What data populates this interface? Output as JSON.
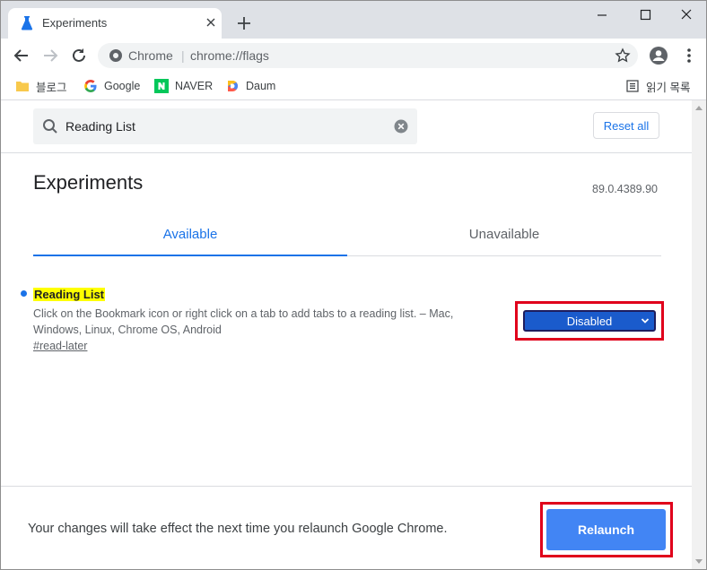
{
  "browser": {
    "tab_title": "Experiments",
    "omnibox_site": "Chrome",
    "omnibox_separator": "|",
    "omnibox_url": "chrome://flags"
  },
  "bookmarks": [
    {
      "label": "블로그",
      "icon": "folder-icon"
    },
    {
      "label": "Google",
      "icon": "google-icon"
    },
    {
      "label": "NAVER",
      "icon": "naver-icon"
    },
    {
      "label": "Daum",
      "icon": "daum-icon"
    }
  ],
  "reading_list_label": "읽기 목록",
  "search": {
    "value": "Reading List",
    "reset_label": "Reset all"
  },
  "page": {
    "title": "Experiments",
    "version": "89.0.4389.90"
  },
  "tabs": {
    "available": "Available",
    "unavailable": "Unavailable",
    "active": "available"
  },
  "flag": {
    "name": "Reading List",
    "description": "Click on the Bookmark icon or right click on a tab to add tabs to a reading list. – Mac, Windows, Linux, Chrome OS, Android",
    "link": "#read-later",
    "selected": "Disabled"
  },
  "footer": {
    "message": "Your changes will take effect the next time you relaunch Google Chrome.",
    "relaunch_label": "Relaunch"
  },
  "colors": {
    "accent": "#1a73e8",
    "highlight": "#ffff00",
    "annotation_red": "#e0001b",
    "relaunch_blue": "#4285f4"
  }
}
